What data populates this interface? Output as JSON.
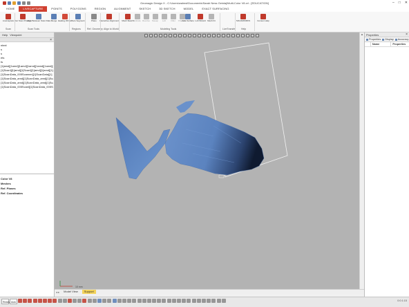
{
  "window": {
    "title": "Geomagic Design X - C:\\Users\\walmsi\\Documents\\Sarah Ness Geinlaj\\Multi-Color V8.xrl - [EDUCATION]",
    "controls": [
      "–",
      "□",
      "✕"
    ]
  },
  "menu": {
    "tabs": [
      {
        "label": "HOME",
        "active": false
      },
      {
        "label": "LIVECAPTURE",
        "active": true
      },
      {
        "label": "POINTS",
        "active": false
      },
      {
        "label": "POLYGONS",
        "active": false
      },
      {
        "label": "REGION",
        "active": false
      },
      {
        "label": "ALIGNMENT",
        "active": false
      },
      {
        "label": "SKETCH",
        "active": false
      },
      {
        "label": "3D SKETCH",
        "active": false
      },
      {
        "label": "MODEL",
        "active": false
      },
      {
        "label": "EXACT SURFACING",
        "active": false
      }
    ]
  },
  "ribbon": {
    "buttons": [
      {
        "label": "LiveCapture",
        "color": "#c0392b"
      },
      {
        "label": "Run Scan Process",
        "color": "#c0392b"
      },
      {
        "label": "Align Between Scan Data",
        "color": "#5b7fb5"
      },
      {
        "label": "Merge",
        "color": "#5b7fb5"
      },
      {
        "label": "Healing Wizard",
        "color": "#d24a3a"
      },
      {
        "label": "Auto Segment",
        "color": "#5b7fb5"
      },
      {
        "label": "Plane",
        "color": "#8a8a8a"
      },
      {
        "label": "Interactive Alignment",
        "color": "#c0392b"
      },
      {
        "label": "Mesh Sketch",
        "color": "#c0392b"
      },
      {
        "label": "Extrude",
        "color": "#b5b5b5"
      },
      {
        "label": "Revolve",
        "color": "#b5b5b5"
      },
      {
        "label": "Sweep",
        "color": "#b5b5b5"
      },
      {
        "label": "Loft",
        "color": "#b5b5b5"
      },
      {
        "label": "Fillet",
        "color": "#b5b5b5"
      },
      {
        "label": "Chamfer",
        "color": "#b5b5b5"
      },
      {
        "label": "Auto Surface",
        "color": "#5b7fb5"
      },
      {
        "label": "Loft Wizard",
        "color": "#c0392b"
      },
      {
        "label": "Mesh Fit",
        "color": "#b5b5b5"
      },
      {
        "label": "SOLIDWORKS",
        "color": "#c0392b"
      },
      {
        "label": "Content Help",
        "color": "#c0392b"
      }
    ],
    "groups": [
      "Scan",
      "Scan Tools",
      "Regions",
      "Ref. Geometry",
      "Align to World",
      "Modeling Tools",
      "LiveTransfer",
      "Help"
    ]
  },
  "left_panel": {
    "tabs": [
      "Help",
      "Viewpoint"
    ],
    "tree_items": [
      "ntext",
      "s",
      "s",
      "ets",
      "ts",
      "[1]amd][1amd][1amd][1amd][1amd][1amd][1amd]",
      "[1]Scanl][1]amd][1]Scanl][1]amd][1]amd][1]amd]",
      "[1]ScanData_005Scanner][1]ScanData][1]",
      "[1]ScanData_amd][1]ScanData_amd][1]ScanData",
      "[1]ScanData_amd][1]ScanData_amd][1]ScanData",
      "[1]ScanData_005Scanl][1]ScanData_005Scan"
    ],
    "properties": [
      "Color V8",
      "Meshes",
      "Ref. Planes",
      "Ref. Coordinates"
    ]
  },
  "right_panel": {
    "title": "Properties",
    "tabs": [
      "Properties",
      "Display",
      "Accuracy"
    ],
    "columns": [
      "Name",
      "Properties"
    ]
  },
  "viewport": {
    "scale_label": "10 mm",
    "background": "#b3b3b3",
    "mesh_color": "#5b83bf"
  },
  "bottom": {
    "tabs": [
      {
        "label": "Model View",
        "highlight": false
      },
      {
        "label": "Support",
        "highlight": true
      }
    ],
    "nav": "◂ ▸"
  },
  "status": {
    "left_field": "Ready",
    "mode_field": "Auto",
    "right_text": "0:0:1:15"
  }
}
